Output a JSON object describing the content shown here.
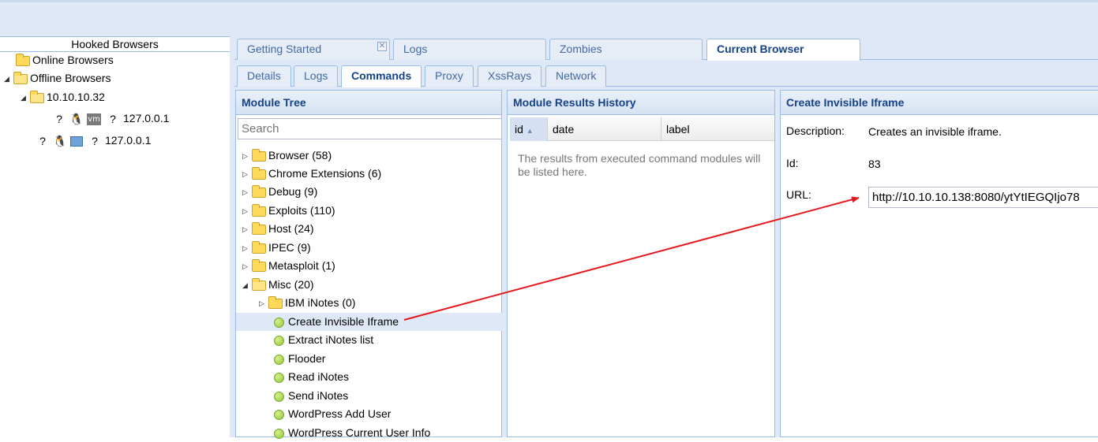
{
  "left": {
    "title": "Hooked Browsers",
    "online": "Online Browsers",
    "offline": "Offline Browsers",
    "host": "10.10.10.32",
    "browser1_ip": "127.0.0.1",
    "browser2_ip": "127.0.0.1",
    "unknown_glyph": "?",
    "vm_badge": "vm"
  },
  "tabs_top": [
    "Getting Started",
    "Logs",
    "Zombies",
    "Current Browser"
  ],
  "tabs_sub": [
    "Details",
    "Logs",
    "Commands",
    "Proxy",
    "XssRays",
    "Network"
  ],
  "module_tree": {
    "title": "Module Tree",
    "search_placeholder": "Search",
    "items": [
      "Browser (58)",
      "Chrome Extensions (6)",
      "Debug (9)",
      "Exploits (110)",
      "Host (24)",
      "IPEC (9)",
      "Metasploit (1)",
      "Misc (20)",
      "IBM iNotes (0)",
      "Create Invisible Iframe",
      "Extract iNotes list",
      "Flooder",
      "Read iNotes",
      "Send iNotes",
      "WordPress Add User",
      "WordPress Current User Info"
    ]
  },
  "results": {
    "title": "Module Results History",
    "col_id": "id",
    "col_date": "date",
    "col_label": "label",
    "empty": "The results from executed command modules will be listed here."
  },
  "detail": {
    "title": "Create Invisible Iframe",
    "description_label": "Description:",
    "description": "Creates an invisible iframe.",
    "id_label": "Id:",
    "id": "83",
    "url_label": "URL:",
    "url": "http://10.10.10.138:8080/ytYtIEGQIjo78"
  },
  "colors": {
    "header_text": "#15428b",
    "border": "#99bbe8",
    "background": "#dfe8f6",
    "arrow": "#e3191c"
  }
}
